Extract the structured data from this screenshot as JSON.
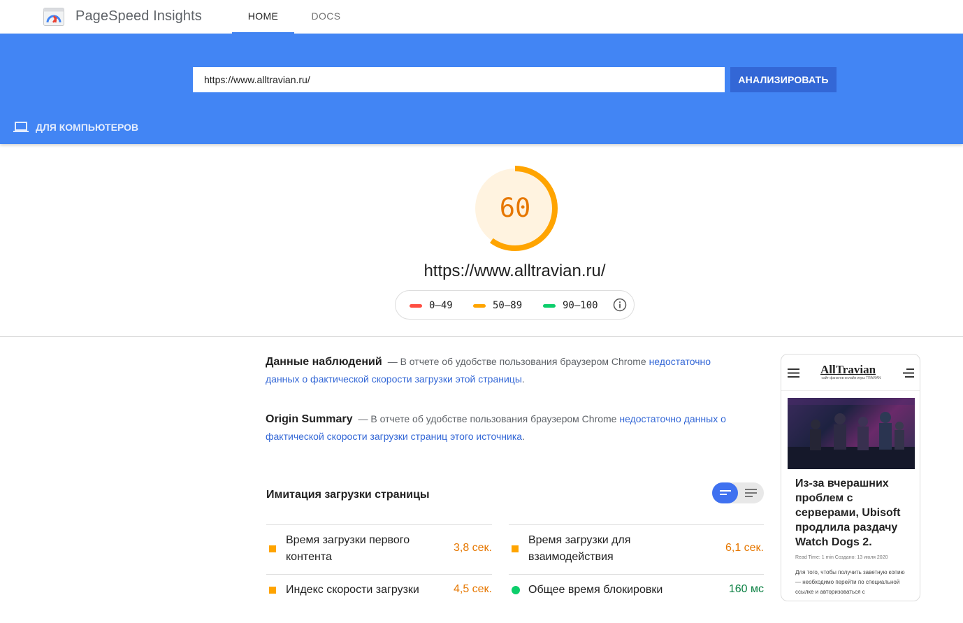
{
  "app": {
    "brand": "PageSpeed Insights",
    "tabs": [
      {
        "label": "HOME",
        "active": true
      },
      {
        "label": "DOCS",
        "active": false
      }
    ]
  },
  "search": {
    "value": "https://www.alltravian.ru/",
    "button_label": "АНАЛИЗИРОВАТЬ"
  },
  "device_tab": {
    "label": "ДЛЯ КОМПЬЮТЕРОВ",
    "icon": "laptop-icon"
  },
  "score": {
    "value": "60",
    "fraction": 0.6,
    "color": "#ffa400",
    "bg": "#fff3e0",
    "url": "https://www.alltravian.ru/"
  },
  "legend": [
    {
      "range": "0–49",
      "color": "#ff4e42"
    },
    {
      "range": "50–89",
      "color": "#ffa400"
    },
    {
      "range": "90–100",
      "color": "#0cce6b"
    }
  ],
  "field_data": {
    "title": "Данные наблюдений",
    "text": "— В отчете об удобстве пользования браузером Chrome ",
    "link": "недостаточно данных о фактической скорости загрузки этой страницы",
    "end": "."
  },
  "origin_summary": {
    "title": "Origin Summary",
    "text": "— В отчете об удобстве пользования браузером Chrome ",
    "link": "недостаточно данных о фактической скорости загрузки страниц этого источника",
    "end": "."
  },
  "lab": {
    "title": "Имитация загрузки страницы",
    "metrics": [
      {
        "label": "Время загрузки первого контента",
        "value": "3,8 сек.",
        "status": "average",
        "color": "#e67700"
      },
      {
        "label": "Время загрузки для взаимодействия",
        "value": "6,1 сек.",
        "status": "average",
        "color": "#e67700"
      },
      {
        "label": "Индекс скорости загрузки",
        "value": "4,5 сек.",
        "status": "average",
        "color": "#e67700"
      },
      {
        "label": "Общее время блокировки",
        "value": "160 мс",
        "status": "pass",
        "color": "#0b8043"
      }
    ]
  },
  "thumbnail": {
    "site_logo": "AllTravian",
    "tagline": "сайт фанатов онлайн игры TRAVIAN",
    "headline": "Из-за вчерашних проблем с серверами, Ubisoft продлила раздачу Watch Dogs 2.",
    "meta": "Read Time: 1 min   Создано: 13 июля 2020",
    "text": "Для того, чтобы получить заветную копию — необходимо перейти по специальной ссылке и авторизоваться с"
  }
}
